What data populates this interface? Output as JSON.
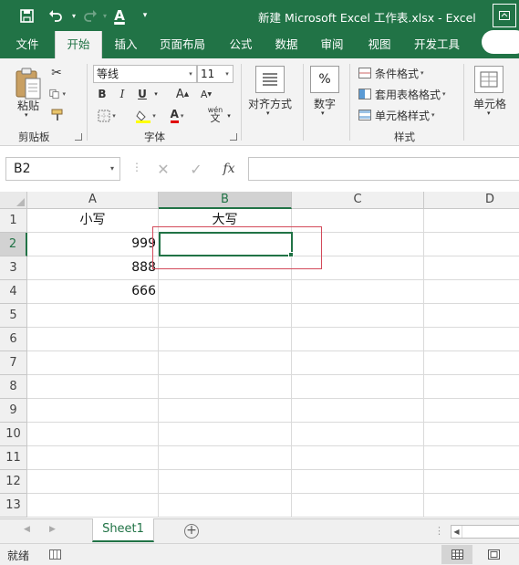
{
  "title_bar": {
    "title": "新建 Microsoft Excel 工作表.xlsx  -  Excel",
    "qat": {
      "save_icon": "save-icon",
      "undo_icon": "undo-icon",
      "redo_icon": "redo-icon",
      "font_color_icon": "font-color-icon",
      "customize_icon": "customize-qat-icon"
    }
  },
  "tabs": [
    "文件",
    "开始",
    "插入",
    "页面布局",
    "公式",
    "数据",
    "审阅",
    "视图",
    "开发工具"
  ],
  "active_tab": "开始",
  "ribbon": {
    "clipboard": {
      "paste": "粘贴",
      "label": "剪贴板"
    },
    "font": {
      "name": "等线",
      "size": "11",
      "bold": "B",
      "italic": "I",
      "underline": "U",
      "grow": "A",
      "shrink": "A",
      "color_letter": "A",
      "wen": "wén",
      "wen_char": "文",
      "label": "字体"
    },
    "alignment": {
      "label": "对齐方式"
    },
    "number": {
      "label": "数字",
      "symbol": "%"
    },
    "styles": {
      "conditional": "条件格式",
      "table": "套用表格格式",
      "cell_styles": "单元格样式",
      "label": "样式"
    },
    "cells": {
      "label": "单元格"
    }
  },
  "formula_bar": {
    "name_box": "B2",
    "cancel": "✕",
    "enter": "✓",
    "fx": "fx",
    "content": ""
  },
  "grid": {
    "columns": [
      "A",
      "B",
      "C",
      "D"
    ],
    "selected_column": "B",
    "rows": [
      "1",
      "2",
      "3",
      "4",
      "5",
      "6",
      "7",
      "8",
      "9",
      "10",
      "11",
      "12",
      "13"
    ],
    "selected_row": "2",
    "cells": {
      "A1": "小写",
      "B1": "大写",
      "A2": "999",
      "A3": "888",
      "A4": "666"
    },
    "active_cell": "B2"
  },
  "sheet_tabs": {
    "sheets": [
      "Sheet1"
    ],
    "add": "+"
  },
  "status_bar": {
    "text": "就绪"
  },
  "colors": {
    "accent": "#217346",
    "highlight_box": "#d34a5a"
  }
}
